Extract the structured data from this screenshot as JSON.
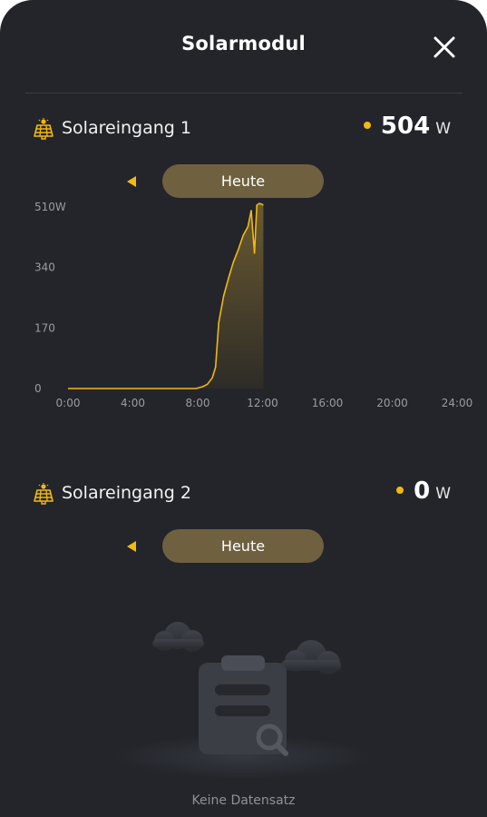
{
  "header": {
    "title": "Solarmodul",
    "close_icon": "close-icon"
  },
  "inputs": [
    {
      "label": "Solareingang 1",
      "icon": "solar-panel-icon",
      "power_value": "504",
      "power_unit": "W",
      "date_label": "Heute",
      "chart_data": {
        "type": "area",
        "x_tick_labels": [
          "0:00",
          "4:00",
          "8:00",
          "12:00",
          "16:00",
          "20:00",
          "24:00"
        ],
        "y_tick_labels": [
          "0",
          "170",
          "340",
          "510W"
        ],
        "xlim": [
          0,
          24
        ],
        "ylim": [
          0,
          510
        ],
        "x_unit": "hours",
        "color": "#f2b90f",
        "series": [
          {
            "x": [
              0,
              7.9,
              8.3,
              8.6,
              8.9,
              9.1,
              9.3,
              9.4,
              9.6,
              9.9,
              10.2,
              10.5,
              10.8,
              11.1,
              11.3,
              11.5,
              11.65,
              11.8,
              11.95,
              12.05
            ],
            "y": [
              0,
              0,
              5,
              12,
              30,
              60,
              185,
              210,
              260,
              310,
              355,
              390,
              430,
              455,
              500,
              380,
              515,
              520,
              518,
              515
            ]
          }
        ]
      }
    },
    {
      "label": "Solareingang 2",
      "icon": "solar-panel-icon",
      "power_value": "0",
      "power_unit": "W",
      "date_label": "Heute"
    }
  ],
  "empty_state": {
    "message": "Keine Datensatz",
    "icon": "empty-clipboard-search-icon"
  },
  "colors": {
    "background": "#23252b",
    "accent": "#f2b90f",
    "pill": "#6f6140"
  }
}
